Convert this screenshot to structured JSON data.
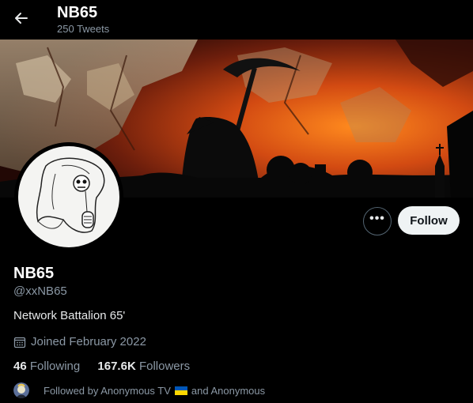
{
  "header": {
    "title": "NB65",
    "tweet_count": "250 Tweets"
  },
  "actions": {
    "more_label": "•••",
    "follow_label": "Follow"
  },
  "profile": {
    "name": "NB65",
    "handle": "@xxNB65",
    "bio": "Network Battalion 65'",
    "joined": "Joined February 2022",
    "following_count": "46",
    "following_label": "Following",
    "followers_count": "167.6K",
    "followers_label": "Followers",
    "followed_by_prefix": "Followed by Anonymous TV",
    "followed_by_suffix": "and Anonymous"
  },
  "icons": {
    "back": "arrow-left-icon",
    "calendar": "calendar-icon",
    "flag": "ukraine-flag-icon"
  },
  "colors": {
    "background": "#000000",
    "text_primary": "#e7e9ea",
    "text_secondary": "#8b98a5",
    "follow_bg": "#eff3f4"
  }
}
